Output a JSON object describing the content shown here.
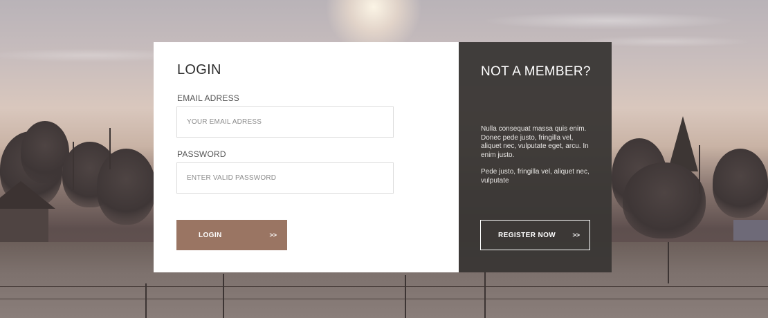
{
  "login": {
    "title": "LOGIN",
    "email_label": "EMAIL ADRESS",
    "email_placeholder": "YOUR EMAIL ADRESS",
    "email_value": "",
    "password_label": "PASSWORD",
    "password_placeholder": "ENTER VALID PASSWORD",
    "password_value": "",
    "button_label": "LOGIN",
    "button_arrow": ">>"
  },
  "register": {
    "title": "NOT A MEMBER?",
    "paragraph_1": "Nulla consequat massa quis enim. Donec pede justo, fringilla vel, aliquet nec, vulputate eget, arcu. In enim justo.",
    "paragraph_2": "Pede justo, fringilla vel, aliquet nec, vulputate",
    "button_label": "REGISTER NOW",
    "button_arrow": ">>"
  },
  "colors": {
    "login_button": "#9a7563",
    "register_panel": "#3a3735",
    "login_panel": "#ffffff"
  },
  "background": {
    "icon": "sunrise-landscape-photo"
  }
}
